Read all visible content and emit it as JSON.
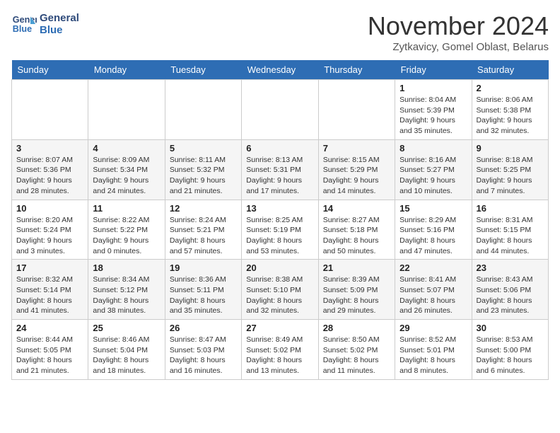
{
  "header": {
    "logo_line1": "General",
    "logo_line2": "Blue",
    "month": "November 2024",
    "location": "Zytkavicy, Gomel Oblast, Belarus"
  },
  "days_of_week": [
    "Sunday",
    "Monday",
    "Tuesday",
    "Wednesday",
    "Thursday",
    "Friday",
    "Saturday"
  ],
  "weeks": [
    [
      {
        "day": "",
        "info": ""
      },
      {
        "day": "",
        "info": ""
      },
      {
        "day": "",
        "info": ""
      },
      {
        "day": "",
        "info": ""
      },
      {
        "day": "",
        "info": ""
      },
      {
        "day": "1",
        "info": "Sunrise: 8:04 AM\nSunset: 5:39 PM\nDaylight: 9 hours\nand 35 minutes."
      },
      {
        "day": "2",
        "info": "Sunrise: 8:06 AM\nSunset: 5:38 PM\nDaylight: 9 hours\nand 32 minutes."
      }
    ],
    [
      {
        "day": "3",
        "info": "Sunrise: 8:07 AM\nSunset: 5:36 PM\nDaylight: 9 hours\nand 28 minutes."
      },
      {
        "day": "4",
        "info": "Sunrise: 8:09 AM\nSunset: 5:34 PM\nDaylight: 9 hours\nand 24 minutes."
      },
      {
        "day": "5",
        "info": "Sunrise: 8:11 AM\nSunset: 5:32 PM\nDaylight: 9 hours\nand 21 minutes."
      },
      {
        "day": "6",
        "info": "Sunrise: 8:13 AM\nSunset: 5:31 PM\nDaylight: 9 hours\nand 17 minutes."
      },
      {
        "day": "7",
        "info": "Sunrise: 8:15 AM\nSunset: 5:29 PM\nDaylight: 9 hours\nand 14 minutes."
      },
      {
        "day": "8",
        "info": "Sunrise: 8:16 AM\nSunset: 5:27 PM\nDaylight: 9 hours\nand 10 minutes."
      },
      {
        "day": "9",
        "info": "Sunrise: 8:18 AM\nSunset: 5:25 PM\nDaylight: 9 hours\nand 7 minutes."
      }
    ],
    [
      {
        "day": "10",
        "info": "Sunrise: 8:20 AM\nSunset: 5:24 PM\nDaylight: 9 hours\nand 3 minutes."
      },
      {
        "day": "11",
        "info": "Sunrise: 8:22 AM\nSunset: 5:22 PM\nDaylight: 9 hours\nand 0 minutes."
      },
      {
        "day": "12",
        "info": "Sunrise: 8:24 AM\nSunset: 5:21 PM\nDaylight: 8 hours\nand 57 minutes."
      },
      {
        "day": "13",
        "info": "Sunrise: 8:25 AM\nSunset: 5:19 PM\nDaylight: 8 hours\nand 53 minutes."
      },
      {
        "day": "14",
        "info": "Sunrise: 8:27 AM\nSunset: 5:18 PM\nDaylight: 8 hours\nand 50 minutes."
      },
      {
        "day": "15",
        "info": "Sunrise: 8:29 AM\nSunset: 5:16 PM\nDaylight: 8 hours\nand 47 minutes."
      },
      {
        "day": "16",
        "info": "Sunrise: 8:31 AM\nSunset: 5:15 PM\nDaylight: 8 hours\nand 44 minutes."
      }
    ],
    [
      {
        "day": "17",
        "info": "Sunrise: 8:32 AM\nSunset: 5:14 PM\nDaylight: 8 hours\nand 41 minutes."
      },
      {
        "day": "18",
        "info": "Sunrise: 8:34 AM\nSunset: 5:12 PM\nDaylight: 8 hours\nand 38 minutes."
      },
      {
        "day": "19",
        "info": "Sunrise: 8:36 AM\nSunset: 5:11 PM\nDaylight: 8 hours\nand 35 minutes."
      },
      {
        "day": "20",
        "info": "Sunrise: 8:38 AM\nSunset: 5:10 PM\nDaylight: 8 hours\nand 32 minutes."
      },
      {
        "day": "21",
        "info": "Sunrise: 8:39 AM\nSunset: 5:09 PM\nDaylight: 8 hours\nand 29 minutes."
      },
      {
        "day": "22",
        "info": "Sunrise: 8:41 AM\nSunset: 5:07 PM\nDaylight: 8 hours\nand 26 minutes."
      },
      {
        "day": "23",
        "info": "Sunrise: 8:43 AM\nSunset: 5:06 PM\nDaylight: 8 hours\nand 23 minutes."
      }
    ],
    [
      {
        "day": "24",
        "info": "Sunrise: 8:44 AM\nSunset: 5:05 PM\nDaylight: 8 hours\nand 21 minutes."
      },
      {
        "day": "25",
        "info": "Sunrise: 8:46 AM\nSunset: 5:04 PM\nDaylight: 8 hours\nand 18 minutes."
      },
      {
        "day": "26",
        "info": "Sunrise: 8:47 AM\nSunset: 5:03 PM\nDaylight: 8 hours\nand 16 minutes."
      },
      {
        "day": "27",
        "info": "Sunrise: 8:49 AM\nSunset: 5:02 PM\nDaylight: 8 hours\nand 13 minutes."
      },
      {
        "day": "28",
        "info": "Sunrise: 8:50 AM\nSunset: 5:02 PM\nDaylight: 8 hours\nand 11 minutes."
      },
      {
        "day": "29",
        "info": "Sunrise: 8:52 AM\nSunset: 5:01 PM\nDaylight: 8 hours\nand 8 minutes."
      },
      {
        "day": "30",
        "info": "Sunrise: 8:53 AM\nSunset: 5:00 PM\nDaylight: 8 hours\nand 6 minutes."
      }
    ]
  ]
}
